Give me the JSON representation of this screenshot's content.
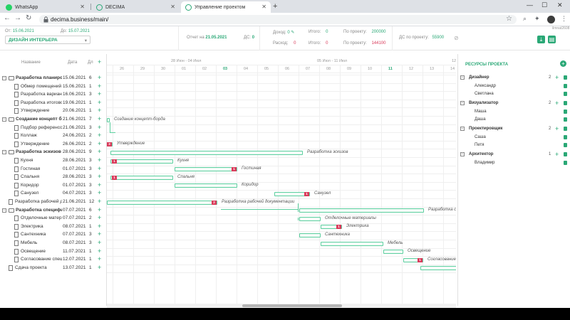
{
  "browser": {
    "tabs": [
      {
        "label": "WhatsApp",
        "icon": "whatsapp-icon",
        "active": false
      },
      {
        "label": "DECIMA",
        "icon": "decima-icon",
        "active": false
      },
      {
        "label": "Управление проектом",
        "icon": "decima-icon",
        "active": true
      }
    ],
    "url": "decima.business/main/"
  },
  "header": {
    "from_label": "От:",
    "from_date": "15.06.2021",
    "to_label": "До:",
    "to_date": "15.07.2021",
    "project_select": "ДИЗАЙН ИНТЕРЬЕРА",
    "report_label": "Отчет на",
    "report_date": "21.05.2021",
    "ds_label": "ДС:",
    "ds_value": "0",
    "income_label": "Доход:",
    "income_value": "0",
    "expense_label": "Расход:",
    "expense_value": "0",
    "total_label1": "Итого:",
    "total_value1": "0",
    "total_label2": "Итого:",
    "total_value2": "0",
    "byproj_label1": "По проекту:",
    "byproj_value1": "200000",
    "byproj_label2": "По проекту:",
    "byproj_value2": "144100",
    "ds_proj_label": "ДС по проекту:",
    "ds_proj_value": "55900",
    "user_tag": "ilmnat2608"
  },
  "columns": {
    "name": "Название",
    "date": "Дата",
    "dur": "Дл"
  },
  "tasks": [
    {
      "name": "Разработка планировок",
      "date": "15.06.2021",
      "dur": "6",
      "level": 0,
      "group": true
    },
    {
      "name": "Обмер помещений",
      "date": "15.06.2021",
      "dur": "1",
      "level": 1,
      "group": false
    },
    {
      "name": "Разработка вариантов",
      "date": "16.06.2021",
      "dur": "3",
      "level": 1,
      "group": false
    },
    {
      "name": "Разработка итогового",
      "date": "19.06.2021",
      "dur": "1",
      "level": 1,
      "group": false
    },
    {
      "name": "Утверждение",
      "date": "20.06.2021",
      "dur": "1",
      "level": 1,
      "group": false
    },
    {
      "name": "Создание концепт борд",
      "date": "21.06.2021",
      "dur": "7",
      "level": 0,
      "group": true
    },
    {
      "name": "Подбор референсов",
      "date": "21.06.2021",
      "dur": "3",
      "level": 1,
      "group": false
    },
    {
      "name": "Коллаж",
      "date": "24.06.2021",
      "dur": "2",
      "level": 1,
      "group": false
    },
    {
      "name": "Утверждение",
      "date": "26.06.2021",
      "dur": "2",
      "level": 1,
      "group": false
    },
    {
      "name": "Разработка эскизов",
      "date": "28.06.2021",
      "dur": "9",
      "level": 0,
      "group": true
    },
    {
      "name": "Кухня",
      "date": "28.06.2021",
      "dur": "3",
      "level": 1,
      "group": false
    },
    {
      "name": "Гостиная",
      "date": "01.07.2021",
      "dur": "3",
      "level": 1,
      "group": false
    },
    {
      "name": "Спальня",
      "date": "28.06.2021",
      "dur": "3",
      "level": 1,
      "group": false
    },
    {
      "name": "Коридор",
      "date": "01.07.2021",
      "dur": "3",
      "level": 1,
      "group": false
    },
    {
      "name": "Санузел",
      "date": "04.07.2021",
      "dur": "3",
      "level": 1,
      "group": false
    },
    {
      "name": "Разработка рабочей док",
      "date": "21.06.2021",
      "dur": "12",
      "level": 0,
      "group": false
    },
    {
      "name": "Разработка специфика",
      "date": "07.07.2021",
      "dur": "6",
      "level": 0,
      "group": true
    },
    {
      "name": "Отделочные материал",
      "date": "07.07.2021",
      "dur": "2",
      "level": 1,
      "group": false
    },
    {
      "name": "Электрика",
      "date": "08.07.2021",
      "dur": "1",
      "level": 1,
      "group": false
    },
    {
      "name": "Сантехника",
      "date": "07.07.2021",
      "dur": "3",
      "level": 1,
      "group": false
    },
    {
      "name": "Мебель",
      "date": "08.07.2021",
      "dur": "3",
      "level": 1,
      "group": false
    },
    {
      "name": "Освещение",
      "date": "11.07.2021",
      "dur": "1",
      "level": 1,
      "group": false
    },
    {
      "name": "Согласование специф",
      "date": "12.07.2021",
      "dur": "1",
      "level": 1,
      "group": false
    },
    {
      "name": "Сдача проекта",
      "date": "13.07.2021",
      "dur": "1",
      "level": 0,
      "group": false
    }
  ],
  "timeline": {
    "weeks": [
      "28 Июн - 04 Июл",
      "05 Июл - 11 Июл",
      "12"
    ],
    "days": [
      "26",
      "29",
      "30",
      "01",
      "02",
      "03",
      "04",
      "05",
      "06",
      "07",
      "08",
      "09",
      "10",
      "11",
      "12",
      "13",
      "14"
    ],
    "today_index": [
      5,
      13
    ]
  },
  "bars": [
    {
      "row": 5,
      "label": "Создание концепт-борда"
    },
    {
      "row": 8,
      "label": "Утверждение",
      "badge": "3"
    },
    {
      "row": 9,
      "label": "Разработка эскизов"
    },
    {
      "row": 10,
      "label": "Кухня",
      "badge": "1"
    },
    {
      "row": 11,
      "label": "Гостиная",
      "badge": "1"
    },
    {
      "row": 12,
      "label": "Спальня",
      "badge": "1"
    },
    {
      "row": 13,
      "label": "Коридор"
    },
    {
      "row": 14,
      "label": "Санузел",
      "badge": "1"
    },
    {
      "row": 15,
      "label": "Разработка рабочей документации",
      "badge": "2"
    },
    {
      "row": 16,
      "label": "Разработка спец"
    },
    {
      "row": 17,
      "label": "Отделочные материалы"
    },
    {
      "row": 18,
      "label": "Электрика",
      "badge": "1"
    },
    {
      "row": 19,
      "label": "Сантехника"
    },
    {
      "row": 20,
      "label": "Мебель"
    },
    {
      "row": 21,
      "label": "Освещение"
    },
    {
      "row": 22,
      "label": "Согласование спе",
      "badge": "1"
    },
    {
      "row": 23,
      "label": "Сдача проекта"
    }
  ],
  "resources": {
    "title": "РЕСУРСЫ ПРОЕКТА",
    "groups": [
      {
        "name": "Дизайнер",
        "count": "2",
        "members": [
          "Александр",
          "Светлана"
        ]
      },
      {
        "name": "Визуализатор",
        "count": "2",
        "members": [
          "Маша",
          "Даша"
        ]
      },
      {
        "name": "Проектировщик",
        "count": "2",
        "members": [
          "Саша",
          "Петя"
        ]
      },
      {
        "name": "Архитектор",
        "count": "1",
        "members": [
          "Владимир"
        ]
      }
    ]
  },
  "colors": {
    "accent": "#2aa876",
    "alert": "#d93b5b",
    "bar_border": "#5ccf9f"
  }
}
